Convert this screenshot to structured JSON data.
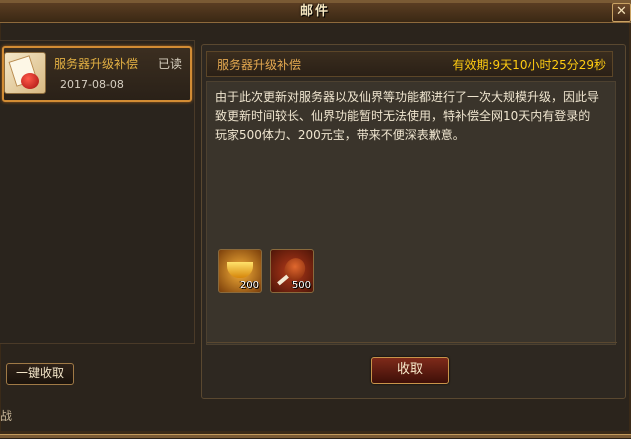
{
  "window": {
    "title": "邮件",
    "close_glyph": "✕"
  },
  "mail_list": {
    "items": [
      {
        "title": "服务器升级补偿",
        "status": "已读",
        "date": "2017-08-08",
        "icon": "mail-gift-icon"
      }
    ],
    "collect_all_label": "一键收取",
    "bottom_text": "战"
  },
  "mail_detail": {
    "title": "服务器升级补偿",
    "expire": "有效期:9天10小时25分29秒",
    "body": "由于此次更新对服务器以及仙界等功能都进行了一次大规模升级，因此导致更新时间较长、仙界功能暂时无法使用，特补偿全网10天内有登录的玩家500体力、200元宝，带来不便深表歉意。",
    "rewards": [
      {
        "icon": "gold-ingot-icon",
        "quantity": "200"
      },
      {
        "icon": "meat-drumstick-icon",
        "quantity": "500"
      }
    ],
    "receive_label": "收取"
  },
  "colors": {
    "accent_gold": "#e3b043",
    "expire_yellow": "#ffcc11",
    "button_red": "#7e2a1a"
  }
}
